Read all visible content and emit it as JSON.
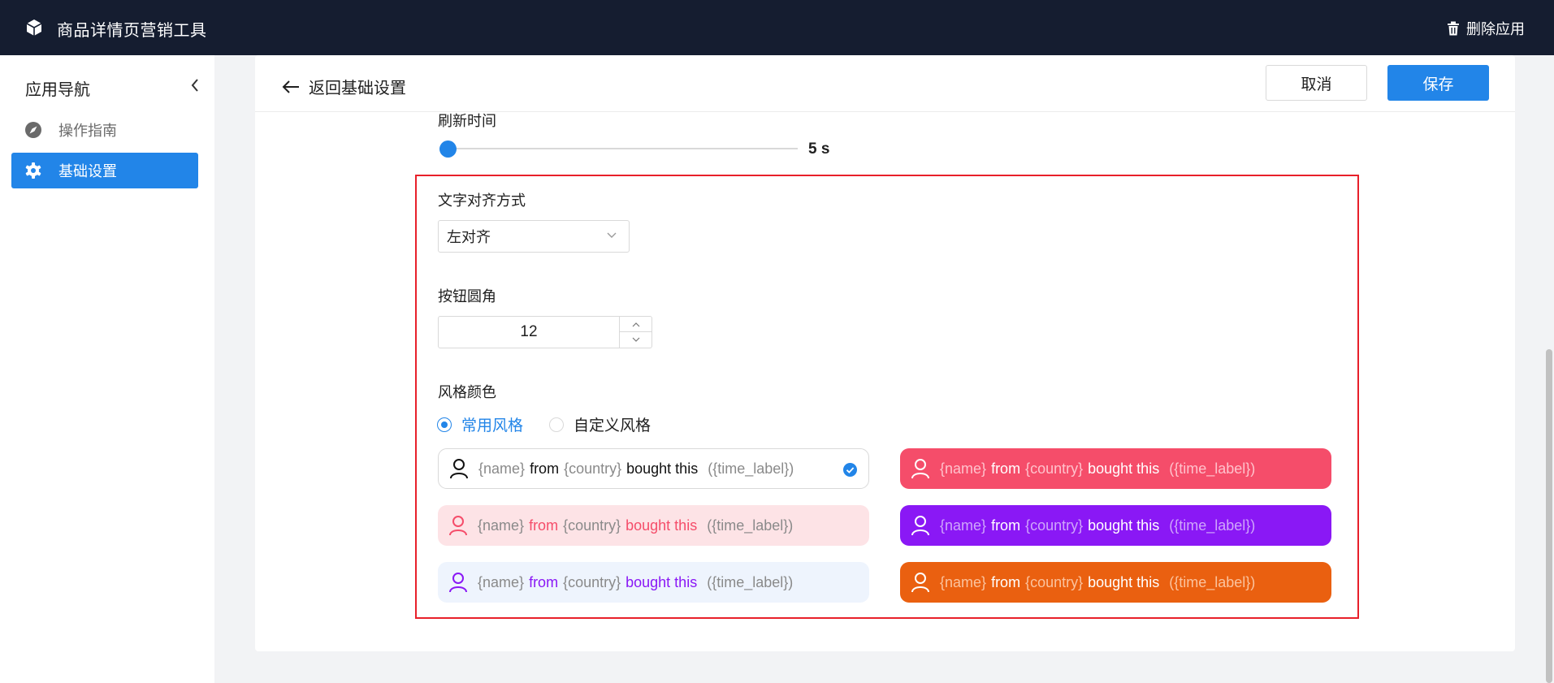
{
  "topbar": {
    "app_title": "商品详情页营销工具",
    "delete_label": "删除应用",
    "logo_icon": "cube-icon",
    "delete_icon": "trash-icon"
  },
  "sidebar": {
    "title": "应用导航",
    "items": [
      {
        "label": "操作指南",
        "icon": "compass-icon",
        "active": false
      },
      {
        "label": "基础设置",
        "icon": "gear-icon",
        "active": true
      }
    ]
  },
  "header": {
    "back_label": "返回基础设置",
    "cancel_label": "取消",
    "save_label": "保存"
  },
  "form": {
    "refresh": {
      "label": "刷新时间",
      "value": "5 s",
      "slider_fraction": 0.0
    },
    "text_align": {
      "label": "文字对齐方式",
      "selected": "左对齐"
    },
    "button_radius": {
      "label": "按钮圆角",
      "value": "12"
    },
    "style_color": {
      "label": "风格颜色",
      "options": [
        "常用风格",
        "自定义风格"
      ],
      "selected": "常用风格"
    }
  },
  "style_presets": [
    {
      "name": "{name}",
      "from": "from",
      "country": "{country}",
      "bought": "bought this",
      "time": "({time_label})",
      "bg": "#ffffff",
      "accent": "#111111",
      "muted": "#8a8a8a",
      "selected": true
    },
    {
      "name": "{name}",
      "from": "from",
      "country": "{country}",
      "bought": "bought this",
      "time": "({time_label})",
      "bg": "#fde3e6",
      "accent": "#f54d6a",
      "muted": "#8a8a8a",
      "selected": false
    },
    {
      "name": "{name}",
      "from": "from",
      "country": "{country}",
      "bought": "bought this",
      "time": "({time_label})",
      "bg": "#eef4fd",
      "accent": "#8a18f5",
      "muted": "#8a8a8a",
      "selected": false
    },
    {
      "name": "{name}",
      "from": "from",
      "country": "{country}",
      "bought": "bought this",
      "time": "({time_label})",
      "bg": "#f54d6a",
      "accent": "#ffffff",
      "muted": "#ffc2cc",
      "selected": false
    },
    {
      "name": "{name}",
      "from": "from",
      "country": "{country}",
      "bought": "bought this",
      "time": "({time_label})",
      "bg": "#8a18f5",
      "accent": "#ffffff",
      "muted": "#cfa6fb",
      "selected": false
    },
    {
      "name": "{name}",
      "from": "from",
      "country": "{country}",
      "bought": "bought this",
      "time": "({time_label})",
      "bg": "#ea6010",
      "accent": "#ffffff",
      "muted": "#fbc39e",
      "selected": false
    }
  ],
  "colors": {
    "topbar": "#151d30",
    "primary": "#2285e8",
    "highlight_border": "#e8202a"
  }
}
